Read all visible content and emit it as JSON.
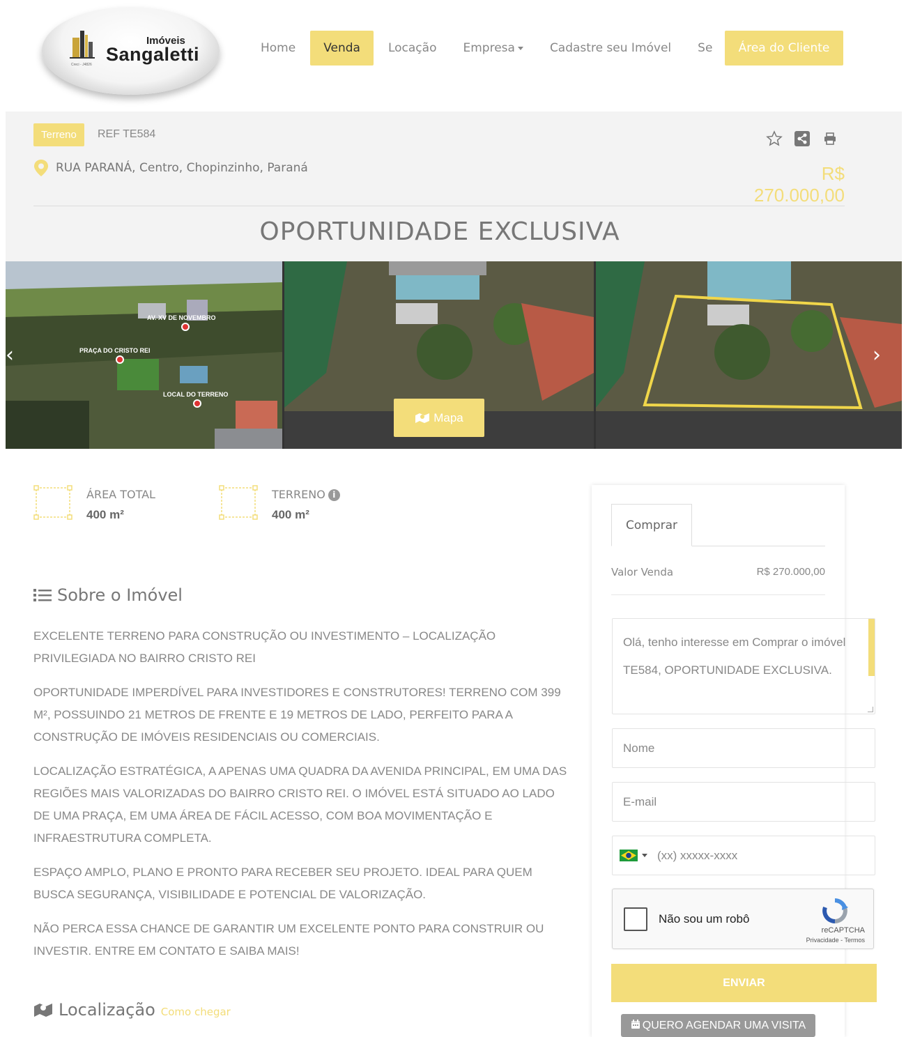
{
  "header": {
    "logo": {
      "top": "Imóveis",
      "name": "Sangaletti",
      "small": "Creci - J4826"
    },
    "nav": [
      {
        "label": "Home"
      },
      {
        "label": "Venda"
      },
      {
        "label": "Locação"
      },
      {
        "label": "Empresa"
      },
      {
        "label": "Cadastre seu Imóvel"
      },
      {
        "label": "Se"
      }
    ],
    "client_button": "Área do Cliente"
  },
  "property": {
    "type_badge": "Terreno",
    "ref": "REF TE584",
    "address": "RUA PARANÁ, Centro, Chopinzinho, Paraná",
    "price": "R$ 270.000,00",
    "title": "OPORTUNIDADE EXCLUSIVA"
  },
  "gallery": {
    "photo_labels": [
      "AV. XV DE NOVEMBRO",
      "PRAÇA DO CRISTO REI",
      "LOCAL DO TERRENO"
    ],
    "map_button": "Mapa"
  },
  "features": [
    {
      "label": "ÁREA TOTAL",
      "value": "400 m²"
    },
    {
      "label": "TERRENO",
      "value": "400 m²"
    }
  ],
  "about": {
    "title": "Sobre o Imóvel",
    "paragraphs": [
      "EXCELENTE TERRENO PARA CONSTRUÇÃO OU INVESTIMENTO – LOCALIZAÇÃO PRIVILEGIADA NO BAIRRO CRISTO REI",
      "OPORTUNIDADE IMPERDÍVEL PARA INVESTIDORES E CONSTRUTORES! TERRENO COM 399 M², POSSUINDO 21 METROS DE FRENTE E 19 METROS DE LADO, PERFEITO PARA A CONSTRUÇÃO DE IMÓVEIS RESIDENCIAIS OU COMERCIAIS.",
      "LOCALIZAÇÃO ESTRATÉGICA, A APENAS UMA QUADRA DA AVENIDA PRINCIPAL, EM UMA DAS REGIÕES MAIS VALORIZADAS DO BAIRRO CRISTO REI. O IMÓVEL ESTÁ SITUADO AO LADO DE UMA PRAÇA, EM UMA ÁREA DE FÁCIL ACESSO, COM BOA MOVIMENTAÇÃO E INFRAESTRUTURA COMPLETA.",
      "ESPAÇO AMPLO, PLANO E PRONTO PARA RECEBER SEU PROJETO. IDEAL PARA QUEM BUSCA SEGURANÇA, VISIBILIDADE E POTENCIAL DE VALORIZAÇÃO.",
      "NÃO PERCA ESSA CHANCE DE GARANTIR UM EXCELENTE PONTO PARA CONSTRUIR OU INVESTIR. ENTRE EM CONTATO E SAIBA MAIS!"
    ]
  },
  "location": {
    "title": "Localização",
    "link": "Como chegar"
  },
  "form": {
    "tab": "Comprar",
    "value_label": "Valor Venda",
    "value": "R$ 270.000,00",
    "message": "Olá, tenho interesse em Comprar o imóvel TE584,  OPORTUNIDADE EXCLUSIVA.",
    "name_placeholder": "Nome",
    "email_placeholder": "E-mail",
    "phone_placeholder": "(xx) xxxxx-xxxx",
    "captcha_text": "Não sou um robô",
    "captcha_brand": "reCAPTCHA",
    "captcha_terms": "Privacidade - Termos",
    "send_button": "ENVIAR",
    "visit_button": "QUERO AGENDAR UMA VISITA"
  },
  "colors": {
    "accent": "#f3dd7a",
    "band": "#f3f3f3"
  }
}
